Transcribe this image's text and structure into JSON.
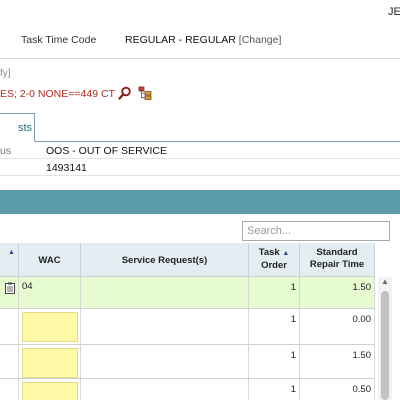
{
  "header": {
    "user_initials": "JE"
  },
  "task_time_code": {
    "label": "Task Time Code",
    "value": "REGULAR - REGULAR",
    "change_link": "[Change]"
  },
  "modify_text": "fy]",
  "codes_text": "ES; 2-0 NONE==449 CT",
  "icons": {
    "search": "search-icon",
    "tree": "tree-icon"
  },
  "tab": {
    "active_label": "sts"
  },
  "info": {
    "rows": [
      {
        "label": "us",
        "value": "OOS - OUT OF SERVICE"
      },
      {
        "label": "",
        "value": "1493141"
      }
    ]
  },
  "search": {
    "placeholder": "Search..."
  },
  "grid": {
    "headers": {
      "first": "",
      "wac": "WAC",
      "service_request": "Service Request(s)",
      "task_order": "Task Order",
      "task_order_line1": "Task",
      "task_order_line2": "Order",
      "standard_repair_time_line1": "Standard",
      "standard_repair_time_line2": "Repair Time"
    },
    "rows": [
      {
        "wac": "04",
        "service_request": "",
        "task_order": "1",
        "standard_repair_time": "1.50",
        "highlight": "green"
      },
      {
        "wac": "",
        "service_request": "",
        "task_order": "1",
        "standard_repair_time": "0.00"
      },
      {
        "wac": "",
        "service_request": "",
        "task_order": "1",
        "standard_repair_time": "1.50"
      },
      {
        "wac": "",
        "service_request": "",
        "task_order": "1",
        "standard_repair_time": "0.50"
      }
    ]
  },
  "colors": {
    "teal_bar": "#5b9bab",
    "codes_red": "#b12a1e",
    "row_green": "#e6fbcf",
    "wac_yellow": "#fff9a6"
  }
}
